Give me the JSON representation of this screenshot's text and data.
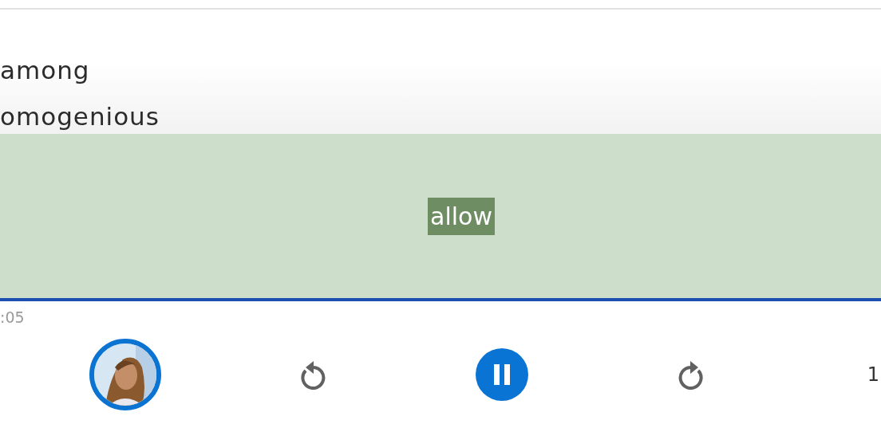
{
  "transcript": {
    "lines": [
      {
        "text": "among"
      },
      {
        "text": "omogenious"
      }
    ]
  },
  "caption": {
    "word": "allow",
    "highlighted": true
  },
  "progress": {
    "level": 1
  },
  "elapsed": ":05",
  "controls": [
    {
      "kind": "avatar"
    },
    {
      "kind": "rewind"
    },
    {
      "kind": "pause"
    },
    {
      "kind": "forward"
    },
    {
      "kind": "speed",
      "label": "1"
    }
  ]
}
